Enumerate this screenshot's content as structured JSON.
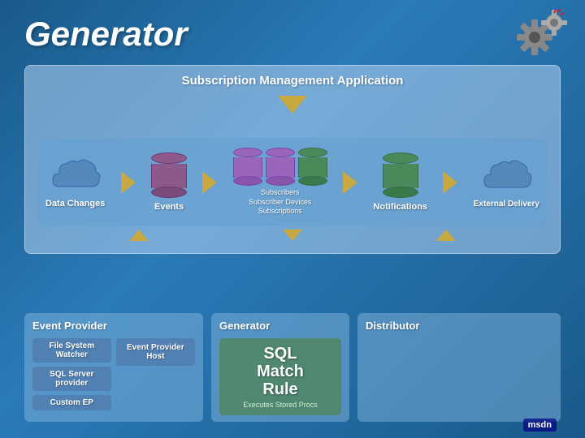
{
  "page": {
    "title": "Generator",
    "subscription_box_title": "Subscription Management Application",
    "data_changes_label": "Data Changes",
    "events_label": "Events",
    "subscribers_label": "Subscribers\nSubscriber Devices\nSubscriptions",
    "subscribers_line1": "Subscribers",
    "subscribers_line2": "Subscriber Devices",
    "subscribers_line3": "Subscriptions",
    "notifications_label": "Notifications",
    "external_delivery_label": "External Delivery",
    "event_provider_title": "Event Provider",
    "file_system_watcher": "File System Watcher",
    "sql_server_provider": "SQL Server provider",
    "custom_ep": "Custom EP",
    "event_provider_host": "Event Provider Host",
    "generator_title": "Generator",
    "sql_match_rule_line1": "SQL",
    "sql_match_rule_line2": "Match",
    "sql_match_rule_line3": "Rule",
    "executes_stored_procs": "Executes Stored Procs",
    "distributor_title": "Distributor",
    "msdn_label": "msdn"
  }
}
